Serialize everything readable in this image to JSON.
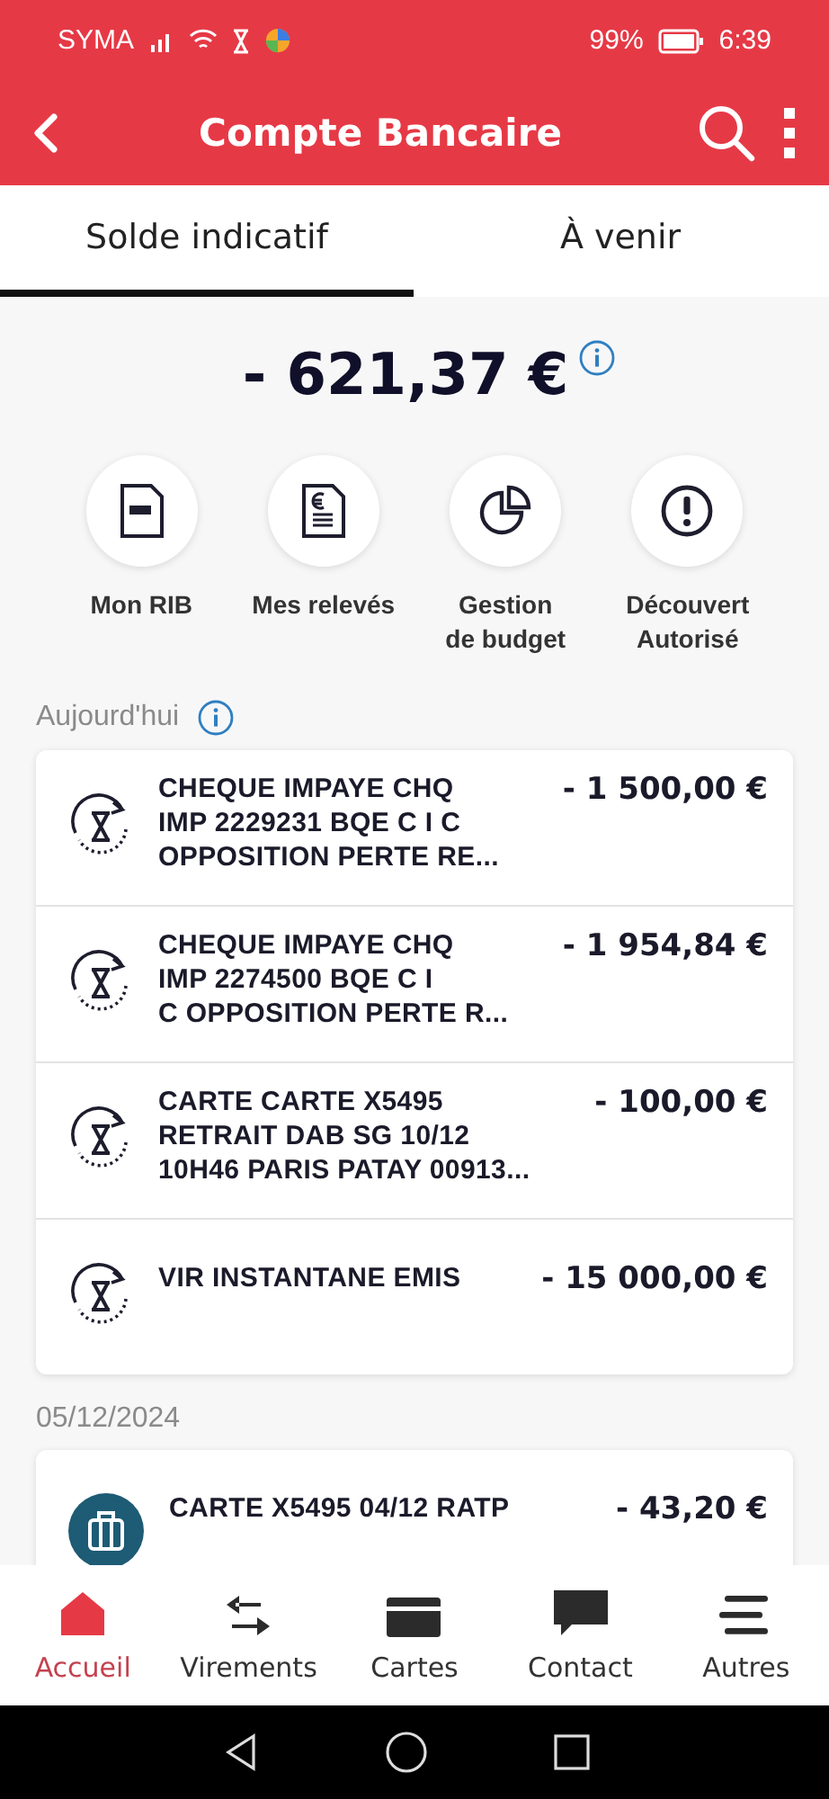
{
  "status_bar": {
    "carrier": "SYMA",
    "battery": "99%",
    "time": "6:39"
  },
  "header": {
    "title": "Compte Bancaire"
  },
  "tabs": [
    {
      "label": "Solde indicatif",
      "selected": true
    },
    {
      "label": "À venir",
      "selected": false
    }
  ],
  "balance": {
    "amount": "- 621,37 €"
  },
  "actions": [
    {
      "kind": "rib",
      "label": "Mon RIB"
    },
    {
      "kind": "statements",
      "label": "Mes relevés"
    },
    {
      "kind": "budget",
      "label": "Gestion\nde budget"
    },
    {
      "kind": "overdraft",
      "label": "Découvert\nAutorisé"
    }
  ],
  "sections": [
    {
      "title": "Aujourd'hui",
      "info": true,
      "transactions": [
        {
          "kind": "pending",
          "description": "CHEQUE IMPAYE CHQ\nIMP 2229231 BQE C I C\nOPPOSITION PERTE RE...",
          "amount": "- 1 500,00 €"
        },
        {
          "kind": "pending",
          "description": "CHEQUE IMPAYE CHQ\nIMP 2274500 BQE C I\nC OPPOSITION PERTE R...",
          "amount": "- 1 954,84 €"
        },
        {
          "kind": "pending",
          "description": "CARTE CARTE X5495\nRETRAIT DAB SG 10/12\n10H46 PARIS PATAY 00913...",
          "amount": "- 100,00 €"
        },
        {
          "kind": "pending",
          "description": "VIR INSTANTANE EMIS",
          "amount": "- 15 000,00 €"
        }
      ]
    },
    {
      "title": "05/12/2024",
      "info": false,
      "transactions": [
        {
          "kind": "travel",
          "description": "CARTE X5495 04/12 RATP",
          "amount": "- 43,20 €"
        }
      ]
    }
  ],
  "bottom_nav": [
    {
      "kind": "home",
      "label": "Accueil",
      "selected": true
    },
    {
      "kind": "transfer",
      "label": "Virements",
      "selected": false
    },
    {
      "kind": "card",
      "label": "Cartes",
      "selected": false
    },
    {
      "kind": "chat",
      "label": "Contact",
      "selected": false
    },
    {
      "kind": "menu",
      "label": "Autres",
      "selected": false
    }
  ]
}
